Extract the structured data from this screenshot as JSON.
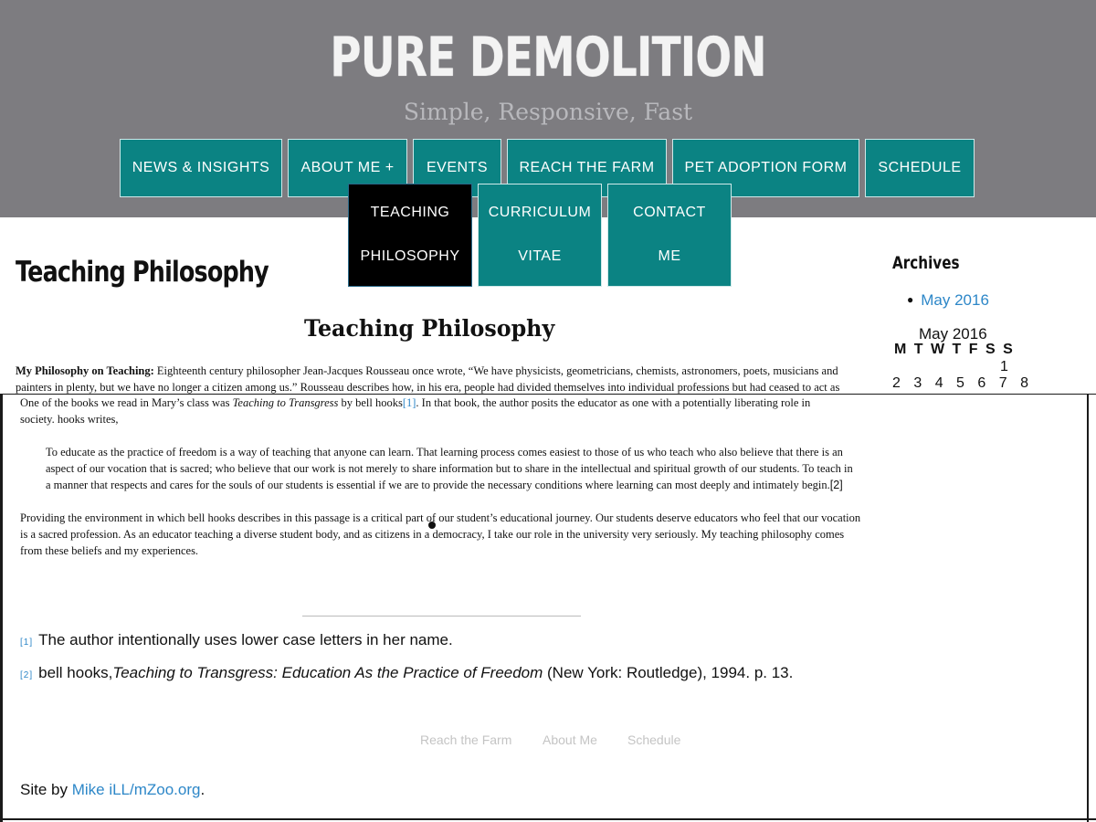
{
  "site": {
    "title": "PURE DEMOLITION",
    "tagline": "Simple, Responsive, Fast"
  },
  "nav": {
    "items": [
      {
        "label": "NEWS & INSIGHTS"
      },
      {
        "label": "ABOUT ME +"
      },
      {
        "label": "EVENTS"
      },
      {
        "label": "REACH THE FARM"
      },
      {
        "label": "PET ADOPTION FORM"
      },
      {
        "label": "SCHEDULE"
      }
    ],
    "submenu": [
      {
        "line1": "TEACHING",
        "line2": "PHILOSOPHY",
        "active": true
      },
      {
        "line1": "CURRICULUM",
        "line2": "VITAE",
        "active": false
      },
      {
        "line1": "CONTACT",
        "line2": "ME",
        "active": false
      }
    ]
  },
  "page": {
    "heading": "Teaching Philosophy",
    "article_title": "Teaching Philosophy",
    "para1_lead": "My Philosophy on Teaching:",
    "para1_text": "  Eighteenth century philosopher Jean-Jacques Rousseau once wrote, “We have physicists, geometricians, chemists, astronomers, poets, musicians and painters in plenty, but we have no longer a citizen among us.” Rousseau describes how, in his era, people had divided themselves into individual professions but had ceased to act as",
    "para2_a": "One of the books we read in Mary’s class was ",
    "para2_book": "Teaching to Transgress",
    "para2_b": " by bell hooks",
    "para2_ref": "[1]",
    "para2_c": ". In that book, the author posits the educator as one with a potentially liberating role in society. hooks writes,",
    "quote_text": "To educate as the practice of freedom is a way of teaching that anyone can learn. That learning process comes easiest to those of us who teach who also believe that there is an aspect of our vocation that is sacred; who believe that our work is not merely to share information but to share in the intellectual and spiritual growth of our students. To teach in a manner that respects and cares for the souls of our students is essential if we are to provide the necessary conditions where learning can most deeply and intimately begin.",
    "quote_ref": "[2]",
    "para3_text": "Providing the environment in which bell hooks describes in this passage is a critical part of our student’s educational journey.  Our students deserve educators who feel that our vocation is a sacred profession.  As an educator teaching a diverse student body, and as citizens in a democracy, I take our role in the university very seriously. My teaching philosophy comes from these beliefs and my experiences."
  },
  "footnotes": [
    {
      "ref": "[1]",
      "text": "The author intentionally uses lower case letters in her name."
    },
    {
      "ref": "[2]",
      "pre": "bell hooks,",
      "italic": "Teaching to Transgress: Education As the Practice of Freedom",
      "post": " (New York: Routledge), 1994. p. 13."
    }
  ],
  "footer": {
    "links": [
      "Reach the Farm",
      "About Me",
      "Schedule"
    ],
    "credit_prefix": "Site by ",
    "credit_link": "Mike iLL/mZoo.org",
    "credit_suffix": "."
  },
  "sidebar": {
    "archives_title": "Archives",
    "archives": [
      "May 2016"
    ],
    "calendar_caption": "May 2016",
    "calendar_head": "M T W T F S S",
    "calendar_row1": "1",
    "calendar_row2": "2 3 4 5 6 7 8"
  },
  "colors": {
    "header_bg": "#7d7c80",
    "nav_bg": "#0b8383",
    "active_bg": "#000000",
    "link": "#2d87c8"
  }
}
